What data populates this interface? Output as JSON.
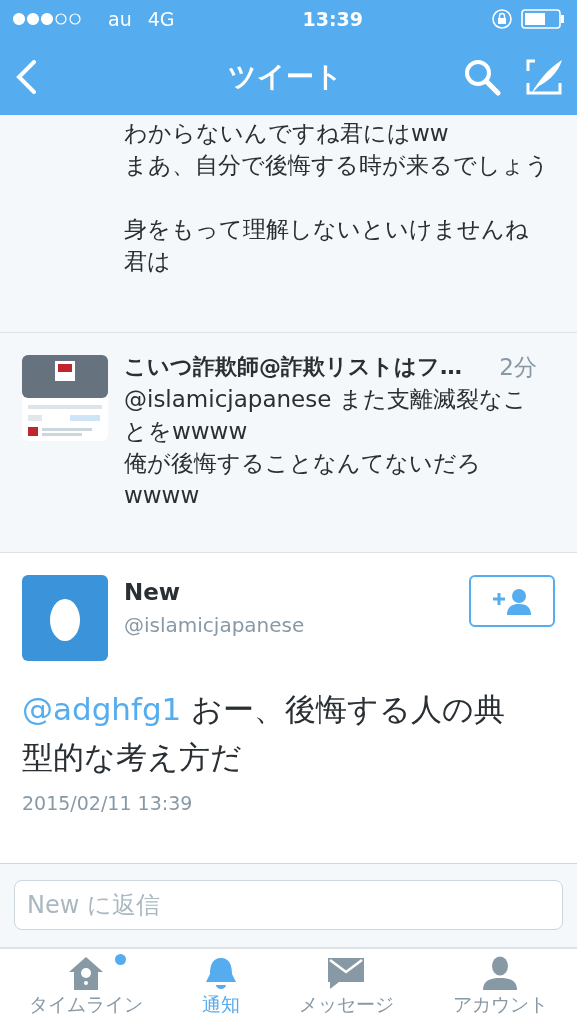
{
  "status_bar": {
    "carrier": "au",
    "network": "4G",
    "time": "13:39"
  },
  "nav": {
    "title": "ツイート"
  },
  "tweets": [
    {
      "paragraphs": [
        [
          "わからないんですね君にはww",
          "まあ、自分で後悔する時が来るでしょう"
        ],
        [
          "身をもって理解しないといけませんね君は"
        ]
      ]
    },
    {
      "name": "こいつ詐欺師@詐欺リストはフ…",
      "time": "2分",
      "paragraphs": [
        [
          "@islamicjapanese また支離滅裂なことをwwww",
          "俺が後悔することなんてないだろwwww"
        ]
      ]
    }
  ],
  "main_tweet": {
    "name": "New",
    "handle": "@islamicjapanese",
    "text": "@adghfg1",
    "text_rest": " おー、後悔する人の典型的な考え方だ",
    "date": "2015/02/11 13:39"
  },
  "reply": {
    "placeholder": "New に返信"
  },
  "tabs": [
    {
      "kind": "home",
      "label": "タイムライン",
      "selected": false,
      "badge": true
    },
    {
      "kind": "bell",
      "label": "通知",
      "selected": true,
      "badge": false
    },
    {
      "kind": "mail",
      "label": "メッセージ",
      "selected": false,
      "badge": false
    },
    {
      "kind": "person",
      "label": "アカウント",
      "selected": false,
      "badge": false
    }
  ]
}
